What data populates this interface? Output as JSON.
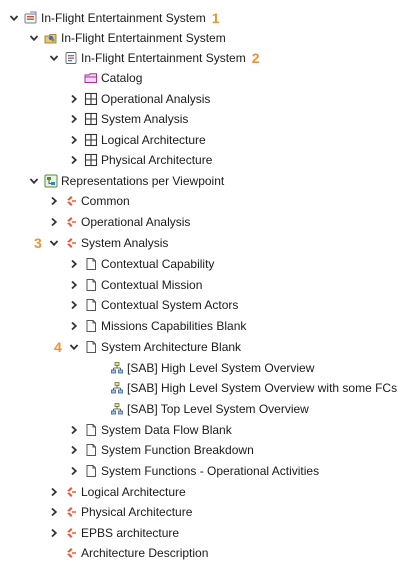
{
  "tree": {
    "root": {
      "label": "In-Flight Entertainment System",
      "callout": "1"
    },
    "project": {
      "label": "In-Flight Entertainment System"
    },
    "model": {
      "label": "In-Flight Entertainment System",
      "callout": "2"
    },
    "catalog": {
      "label": "Catalog"
    },
    "layers": [
      {
        "label": "Operational Analysis"
      },
      {
        "label": "System Analysis"
      },
      {
        "label": "Logical Architecture"
      },
      {
        "label": "Physical Architecture"
      }
    ],
    "representations": {
      "label": "Representations per Viewpoint"
    },
    "viewpoints": {
      "common": {
        "label": "Common"
      },
      "operational": {
        "label": "Operational Analysis"
      },
      "system": {
        "label": "System Analysis",
        "callout": "3"
      },
      "logical": {
        "label": "Logical Architecture"
      },
      "physical": {
        "label": "Physical Architecture"
      },
      "epbs": {
        "label": "EPBS architecture"
      },
      "architecture_description": {
        "label": "Architecture Description"
      }
    },
    "system_folders": [
      {
        "label": "Contextual Capability"
      },
      {
        "label": "Contextual Mission"
      },
      {
        "label": "Contextual System Actors"
      },
      {
        "label": "Missions Capabilities Blank"
      },
      {
        "label": "System Architecture Blank",
        "callout": "4"
      },
      {
        "label": "System Data Flow Blank"
      },
      {
        "label": "System Function Breakdown"
      },
      {
        "label": "System Functions - Operational Activities"
      }
    ],
    "sab_diagrams": [
      {
        "label": "[SAB] High Level System Overview"
      },
      {
        "label": "[SAB] High Level System Overview with some FCs"
      },
      {
        "label": "[SAB] Top Level System Overview"
      }
    ]
  },
  "colors": {
    "accent": "#f0922c",
    "folder": "#c040c0",
    "viewpoint": "#e8593c",
    "text": "#1a1a1a"
  }
}
